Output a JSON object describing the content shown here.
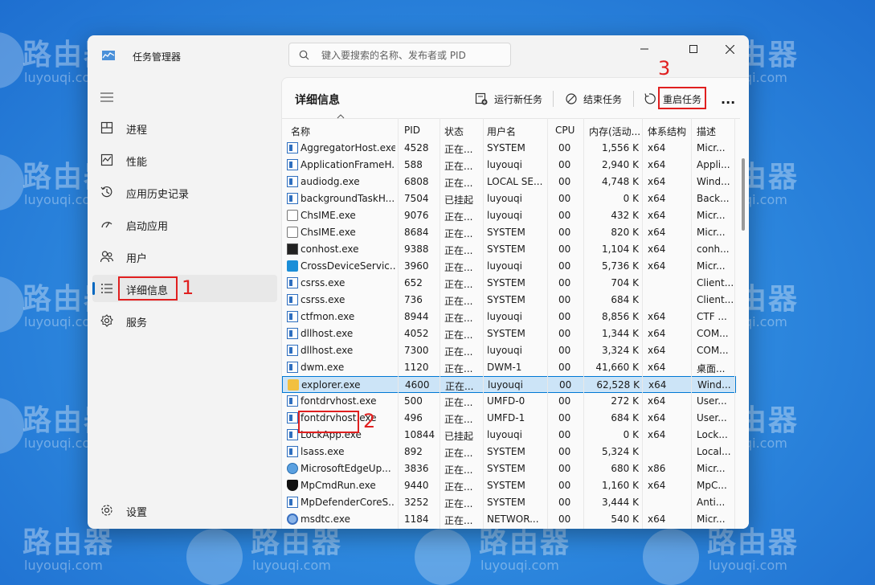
{
  "watermark": {
    "brand": "路由器",
    "domain": "luyouqi.com"
  },
  "window": {
    "title": "任务管理器",
    "search_placeholder": "键入要搜索的名称、发布者或 PID"
  },
  "sidebar": {
    "items": [
      {
        "label": "进程",
        "icon": "processes-icon"
      },
      {
        "label": "性能",
        "icon": "performance-icon"
      },
      {
        "label": "应用历史记录",
        "icon": "app-history-icon"
      },
      {
        "label": "启动应用",
        "icon": "startup-icon"
      },
      {
        "label": "用户",
        "icon": "users-icon"
      },
      {
        "label": "详细信息",
        "icon": "details-icon",
        "active": true
      },
      {
        "label": "服务",
        "icon": "services-icon"
      }
    ],
    "settings_label": "设置"
  },
  "toolbar": {
    "page_title": "详细信息",
    "run_new_task": "运行新任务",
    "end_task": "结束任务",
    "restart_task": "重启任务",
    "more": "..."
  },
  "annotations": {
    "one": "1",
    "two": "2",
    "three": "3"
  },
  "table": {
    "columns": [
      "名称",
      "PID",
      "状态",
      "用户名",
      "CPU",
      "内存(活动...",
      "体系结构",
      "描述"
    ],
    "rows": [
      {
        "icon": "app",
        "name": "AggregatorHost.exe",
        "pid": "4528",
        "status": "正在...",
        "user": "SYSTEM",
        "cpu": "00",
        "mem": "1,556 K",
        "arch": "x64",
        "desc": "Micr..."
      },
      {
        "icon": "app",
        "name": "ApplicationFrameH...",
        "pid": "588",
        "status": "正在...",
        "user": "luyouqi",
        "cpu": "00",
        "mem": "2,940 K",
        "arch": "x64",
        "desc": "Appli..."
      },
      {
        "icon": "app",
        "name": "audiodg.exe",
        "pid": "6808",
        "status": "正在...",
        "user": "LOCAL SE...",
        "cpu": "00",
        "mem": "4,748 K",
        "arch": "x64",
        "desc": "Wind..."
      },
      {
        "icon": "app",
        "name": "backgroundTaskH...",
        "pid": "7504",
        "status": "已挂起",
        "user": "luyouqi",
        "cpu": "00",
        "mem": "0 K",
        "arch": "x64",
        "desc": "Back..."
      },
      {
        "icon": "ime",
        "name": "ChsIME.exe",
        "pid": "9076",
        "status": "正在...",
        "user": "luyouqi",
        "cpu": "00",
        "mem": "432 K",
        "arch": "x64",
        "desc": "Micr..."
      },
      {
        "icon": "ime",
        "name": "ChsIME.exe",
        "pid": "8684",
        "status": "正在...",
        "user": "SYSTEM",
        "cpu": "00",
        "mem": "820 K",
        "arch": "x64",
        "desc": "Micr..."
      },
      {
        "icon": "con",
        "name": "conhost.exe",
        "pid": "9388",
        "status": "正在...",
        "user": "SYSTEM",
        "cpu": "00",
        "mem": "1,104 K",
        "arch": "x64",
        "desc": "conh..."
      },
      {
        "icon": "cross",
        "name": "CrossDeviceServic...",
        "pid": "3960",
        "status": "正在...",
        "user": "luyouqi",
        "cpu": "00",
        "mem": "5,736 K",
        "arch": "x64",
        "desc": "Micr..."
      },
      {
        "icon": "app",
        "name": "csrss.exe",
        "pid": "652",
        "status": "正在...",
        "user": "SYSTEM",
        "cpu": "00",
        "mem": "704 K",
        "arch": "",
        "desc": "Client..."
      },
      {
        "icon": "app",
        "name": "csrss.exe",
        "pid": "736",
        "status": "正在...",
        "user": "SYSTEM",
        "cpu": "00",
        "mem": "684 K",
        "arch": "",
        "desc": "Client..."
      },
      {
        "icon": "app",
        "name": "ctfmon.exe",
        "pid": "8944",
        "status": "正在...",
        "user": "luyouqi",
        "cpu": "00",
        "mem": "8,856 K",
        "arch": "x64",
        "desc": "CTF ..."
      },
      {
        "icon": "app",
        "name": "dllhost.exe",
        "pid": "4052",
        "status": "正在...",
        "user": "SYSTEM",
        "cpu": "00",
        "mem": "1,344 K",
        "arch": "x64",
        "desc": "COM..."
      },
      {
        "icon": "app",
        "name": "dllhost.exe",
        "pid": "7300",
        "status": "正在...",
        "user": "luyouqi",
        "cpu": "00",
        "mem": "3,324 K",
        "arch": "x64",
        "desc": "COM..."
      },
      {
        "icon": "app",
        "name": "dwm.exe",
        "pid": "1120",
        "status": "正在...",
        "user": "DWM-1",
        "cpu": "00",
        "mem": "41,660 K",
        "arch": "x64",
        "desc": "桌面..."
      },
      {
        "icon": "folder",
        "name": "explorer.exe",
        "pid": "4600",
        "status": "正在...",
        "user": "luyouqi",
        "cpu": "00",
        "mem": "62,528 K",
        "arch": "x64",
        "desc": "Wind...",
        "selected": true
      },
      {
        "icon": "app",
        "name": "fontdrvhost.exe",
        "pid": "500",
        "status": "正在...",
        "user": "UMFD-0",
        "cpu": "00",
        "mem": "272 K",
        "arch": "x64",
        "desc": "User..."
      },
      {
        "icon": "app",
        "name": "fontdrvhost.exe",
        "pid": "496",
        "status": "正在...",
        "user": "UMFD-1",
        "cpu": "00",
        "mem": "684 K",
        "arch": "x64",
        "desc": "User..."
      },
      {
        "icon": "app",
        "name": "LockApp.exe",
        "pid": "10844",
        "status": "已挂起",
        "user": "luyouqi",
        "cpu": "00",
        "mem": "0 K",
        "arch": "x64",
        "desc": "Lock..."
      },
      {
        "icon": "app",
        "name": "lsass.exe",
        "pid": "892",
        "status": "正在...",
        "user": "SYSTEM",
        "cpu": "00",
        "mem": "5,324 K",
        "arch": "",
        "desc": "Local..."
      },
      {
        "icon": "edge",
        "name": "MicrosoftEdgeUp...",
        "pid": "3836",
        "status": "正在...",
        "user": "SYSTEM",
        "cpu": "00",
        "mem": "680 K",
        "arch": "x86",
        "desc": "Micr..."
      },
      {
        "icon": "shield",
        "name": "MpCmdRun.exe",
        "pid": "9440",
        "status": "正在...",
        "user": "SYSTEM",
        "cpu": "00",
        "mem": "1,160 K",
        "arch": "x64",
        "desc": "MpC..."
      },
      {
        "icon": "app",
        "name": "MpDefenderCoreS...",
        "pid": "3252",
        "status": "正在...",
        "user": "SYSTEM",
        "cpu": "00",
        "mem": "3,444 K",
        "arch": "",
        "desc": "Anti..."
      },
      {
        "icon": "msdtc",
        "name": "msdtc.exe",
        "pid": "1184",
        "status": "正在...",
        "user": "NETWOR...",
        "cpu": "00",
        "mem": "540 K",
        "arch": "x64",
        "desc": "Micr..."
      }
    ]
  }
}
